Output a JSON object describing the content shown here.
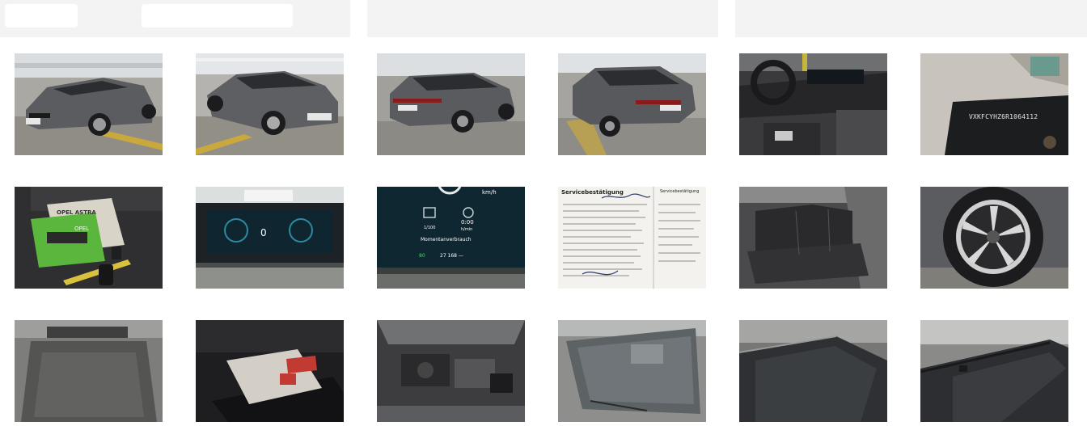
{
  "header": {
    "fields": [
      "",
      ""
    ]
  },
  "gallery": {
    "photos": [
      {
        "id": "front-left",
        "icon": "car-front-icon"
      },
      {
        "id": "front-right",
        "icon": "car-front-icon"
      },
      {
        "id": "rear-left",
        "icon": "car-rear-icon"
      },
      {
        "id": "rear-right",
        "icon": "car-rear-icon"
      },
      {
        "id": "cockpit",
        "icon": "steering-wheel-icon"
      },
      {
        "id": "vin-plate",
        "icon": "vin-icon"
      },
      {
        "id": "manual-keys",
        "icon": "key-icon"
      },
      {
        "id": "dashboard",
        "icon": "display-icon"
      },
      {
        "id": "instrument-cluster",
        "icon": "gauge-icon"
      },
      {
        "id": "inspection-document",
        "icon": "document-icon"
      },
      {
        "id": "rear-seats",
        "icon": "seat-icon"
      },
      {
        "id": "wheel",
        "icon": "wheel-icon"
      },
      {
        "id": "trunk",
        "icon": "trunk-icon"
      },
      {
        "id": "trunk-kit",
        "icon": "package-icon"
      },
      {
        "id": "engine-bay",
        "icon": "engine-icon"
      },
      {
        "id": "windshield",
        "icon": "windshield-icon"
      },
      {
        "id": "roof-left",
        "icon": "roof-icon"
      },
      {
        "id": "roof-right",
        "icon": "roof-icon"
      }
    ]
  },
  "texts": {
    "vin": "VXKFCYHZ6R1064112",
    "manual_title": "OPEL ASTRA",
    "manual_sub": "OPEL",
    "cluster_speed_unit": "km/h",
    "cluster_time": "0:00",
    "cluster_left": "1/100",
    "cluster_right": "h/min",
    "cluster_label": "Momentanverbrauch",
    "cluster_odo": "27 168 —",
    "cluster_range": "80",
    "dash_speed": "0",
    "doc_title": "Servicebestätigung",
    "doc_title2": "Servicebestätigung"
  },
  "colors": {
    "header_bg": "#f3f3f3",
    "field_bg": "#ffffff",
    "car_paint": "#5b5c60",
    "garage_floor": "#8f8d86",
    "cluster_bg": "#0e2731"
  }
}
